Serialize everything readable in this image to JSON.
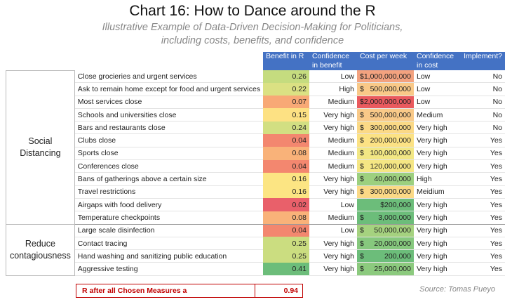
{
  "title": "Chart 16: How to Dance around the R",
  "subtitle_line1": "Illustrative Example of Data-Driven Decision-Making for Politicians,",
  "subtitle_line2": "including costs, benefits, and confidence",
  "headers": [
    "Benefit in R",
    "Confidence in benefit",
    "Cost per week",
    "Confidence in cost",
    "Implement?"
  ],
  "categories": [
    {
      "label": "Social Distancing",
      "rows": 12
    },
    {
      "label": "Reduce contagiousness",
      "rows": 4
    }
  ],
  "rows": [
    {
      "measure": "Close grocieries and urgent services",
      "benefit": "0.26",
      "benefit_color": "#c5dc7f",
      "conf": "Low",
      "cost_dollar": "",
      "cost_amount": "$1,000,000,000",
      "cost_color": "#f3a27f",
      "cost_conf": "Low",
      "implement": "No"
    },
    {
      "measure": "Ask to remain home except for food and urgent services",
      "benefit": "0.22",
      "benefit_color": "#dbe183",
      "conf": "High",
      "cost_dollar": "$",
      "cost_amount": "500,000,000",
      "cost_color": "#f9c988",
      "cost_conf": "Low",
      "implement": "No"
    },
    {
      "measure": "Most services close",
      "benefit": "0.07",
      "benefit_color": "#f8a976",
      "conf": "Medium",
      "cost_dollar": "",
      "cost_amount": "$2,000,000,000",
      "cost_color": "#ea5a5e",
      "cost_conf": "Low",
      "implement": "No"
    },
    {
      "measure": "Schools and universities close",
      "benefit": "0.15",
      "benefit_color": "#fde183",
      "conf": "Very high",
      "cost_dollar": "$",
      "cost_amount": "500,000,000",
      "cost_color": "#f9c988",
      "cost_conf": "Medium",
      "implement": "No"
    },
    {
      "measure": "Bars and restaurants close",
      "benefit": "0.24",
      "benefit_color": "#d2df82",
      "conf": "Very high",
      "cost_dollar": "$",
      "cost_amount": "300,000,000",
      "cost_color": "#fbd986",
      "cost_conf": "Very high",
      "implement": "No"
    },
    {
      "measure": "Clubs close",
      "benefit": "0.04",
      "benefit_color": "#f3876f",
      "conf": "Medium",
      "cost_dollar": "$",
      "cost_amount": "200,000,000",
      "cost_color": "#fce284",
      "cost_conf": "Very high",
      "implement": "Yes"
    },
    {
      "measure": "Sports close",
      "benefit": "0.08",
      "benefit_color": "#f9b279",
      "conf": "Medium",
      "cost_dollar": "$",
      "cost_amount": "100,000,000",
      "cost_color": "#f2e784",
      "cost_conf": "Very high",
      "implement": "Yes"
    },
    {
      "measure": "Conferences close",
      "benefit": "0.04",
      "benefit_color": "#f3876f",
      "conf": "Medium",
      "cost_dollar": "$",
      "cost_amount": "120,000,000",
      "cost_color": "#f5e684",
      "cost_conf": "Very high",
      "implement": "Yes"
    },
    {
      "measure": "Bans of gatherings above a certain size",
      "benefit": "0.16",
      "benefit_color": "#fce583",
      "conf": "Very high",
      "cost_dollar": "$",
      "cost_amount": "40,000,000",
      "cost_color": "#9dd07f",
      "cost_conf": "High",
      "implement": "Yes"
    },
    {
      "measure": "Travel restrictions",
      "benefit": "0.16",
      "benefit_color": "#fce583",
      "conf": "Very high",
      "cost_dollar": "$",
      "cost_amount": "300,000,000",
      "cost_color": "#fbd986",
      "cost_conf": "Meidium",
      "implement": "Yes"
    },
    {
      "measure": "Airgaps with food delivery",
      "benefit": "0.02",
      "benefit_color": "#e9606a",
      "conf": "Low",
      "cost_dollar": "",
      "cost_amount": "$200,000",
      "cost_color": "#6cbd7a",
      "cost_conf": "Very high",
      "implement": "Yes"
    },
    {
      "measure": "Temperature checkpoints",
      "benefit": "0.08",
      "benefit_color": "#f9b279",
      "conf": "Medium",
      "cost_dollar": "$",
      "cost_amount": "3,000,000",
      "cost_color": "#6cbd7a",
      "cost_conf": "Very high",
      "implement": "Yes"
    },
    {
      "measure": "Large scale disinfection",
      "benefit": "0.04",
      "benefit_color": "#f3876f",
      "conf": "Low",
      "cost_dollar": "$",
      "cost_amount": "50,000,000",
      "cost_color": "#a5d27f",
      "cost_conf": "Very high",
      "implement": "Yes"
    },
    {
      "measure": "Contact tracing",
      "benefit": "0.25",
      "benefit_color": "#cbdd80",
      "conf": "Very high",
      "cost_dollar": "$",
      "cost_amount": "20,000,000",
      "cost_color": "#86c87d",
      "cost_conf": "Very high",
      "implement": "Yes"
    },
    {
      "measure": "Hand washing and sanitizing public education",
      "benefit": "0.25",
      "benefit_color": "#cbdd80",
      "conf": "Very high",
      "cost_dollar": "$",
      "cost_amount": "200,000",
      "cost_color": "#6cbd7a",
      "cost_conf": "Very high",
      "implement": "Yes"
    },
    {
      "measure": "Aggressive testing",
      "benefit": "0.41",
      "benefit_color": "#6cbd7a",
      "conf": "Very high",
      "cost_dollar": "$",
      "cost_amount": "25,000,000",
      "cost_color": "#8cca7e",
      "cost_conf": "Very high",
      "implement": "Yes"
    }
  ],
  "footer": {
    "label": "R after all Chosen Measures a",
    "value": "0.94",
    "color": "#c00000"
  },
  "source": "Source: Tomas Pueyo",
  "colors": {
    "header_bg": "#4472c4",
    "header_text": "#ffffff"
  },
  "chart_data": {
    "type": "table",
    "title": "Chart 16: How to Dance around the R",
    "columns": [
      "",
      "",
      "Benefit in R",
      "Confidence in benefit",
      "Cost per week",
      "Confidence in cost",
      "Implement?"
    ],
    "values": [
      [
        "Social Distancing",
        "Close grocieries and urgent services",
        0.26,
        "Low",
        "$1,000,000,000",
        "Low",
        "No"
      ],
      [
        "Social Distancing",
        "Ask to remain home except for food and urgent services",
        0.22,
        "High",
        "$500,000,000",
        "Low",
        "No"
      ],
      [
        "Social Distancing",
        "Most services close",
        0.07,
        "Medium",
        "$2,000,000,000",
        "Low",
        "No"
      ],
      [
        "Social Distancing",
        "Schools and universities close",
        0.15,
        "Very high",
        "$500,000,000",
        "Medium",
        "No"
      ],
      [
        "Social Distancing",
        "Bars and restaurants close",
        0.24,
        "Very high",
        "$300,000,000",
        "Very high",
        "No"
      ],
      [
        "Social Distancing",
        "Clubs close",
        0.04,
        "Medium",
        "$200,000,000",
        "Very high",
        "Yes"
      ],
      [
        "Social Distancing",
        "Sports close",
        0.08,
        "Medium",
        "$100,000,000",
        "Very high",
        "Yes"
      ],
      [
        "Social Distancing",
        "Conferences close",
        0.04,
        "Medium",
        "$120,000,000",
        "Very high",
        "Yes"
      ],
      [
        "Social Distancing",
        "Bans of gatherings above a certain size",
        0.16,
        "Very high",
        "$40,000,000",
        "High",
        "Yes"
      ],
      [
        "Social Distancing",
        "Travel restrictions",
        0.16,
        "Very high",
        "$300,000,000",
        "Meidium",
        "Yes"
      ],
      [
        "Social Distancing",
        "Airgaps with food delivery",
        0.02,
        "Low",
        "$200,000",
        "Very high",
        "Yes"
      ],
      [
        "Social Distancing",
        "Temperature checkpoints",
        0.08,
        "Medium",
        "$3,000,000",
        "Very high",
        "Yes"
      ],
      [
        "Reduce contagiousness",
        "Large scale disinfection",
        0.04,
        "Low",
        "$50,000,000",
        "Very high",
        "Yes"
      ],
      [
        "Reduce contagiousness",
        "Contact tracing",
        0.25,
        "Very high",
        "$20,000,000",
        "Very high",
        "Yes"
      ],
      [
        "Reduce contagiousness",
        "Hand washing and sanitizing public education",
        0.25,
        "Very high",
        "$200,000",
        "Very high",
        "Yes"
      ],
      [
        "Reduce contagiousness",
        "Aggressive testing",
        0.41,
        "Very high",
        "$25,000,000",
        "Very high",
        "Yes"
      ]
    ],
    "summary": {
      "label": "R after all Chosen Measures a",
      "value": 0.94
    }
  }
}
